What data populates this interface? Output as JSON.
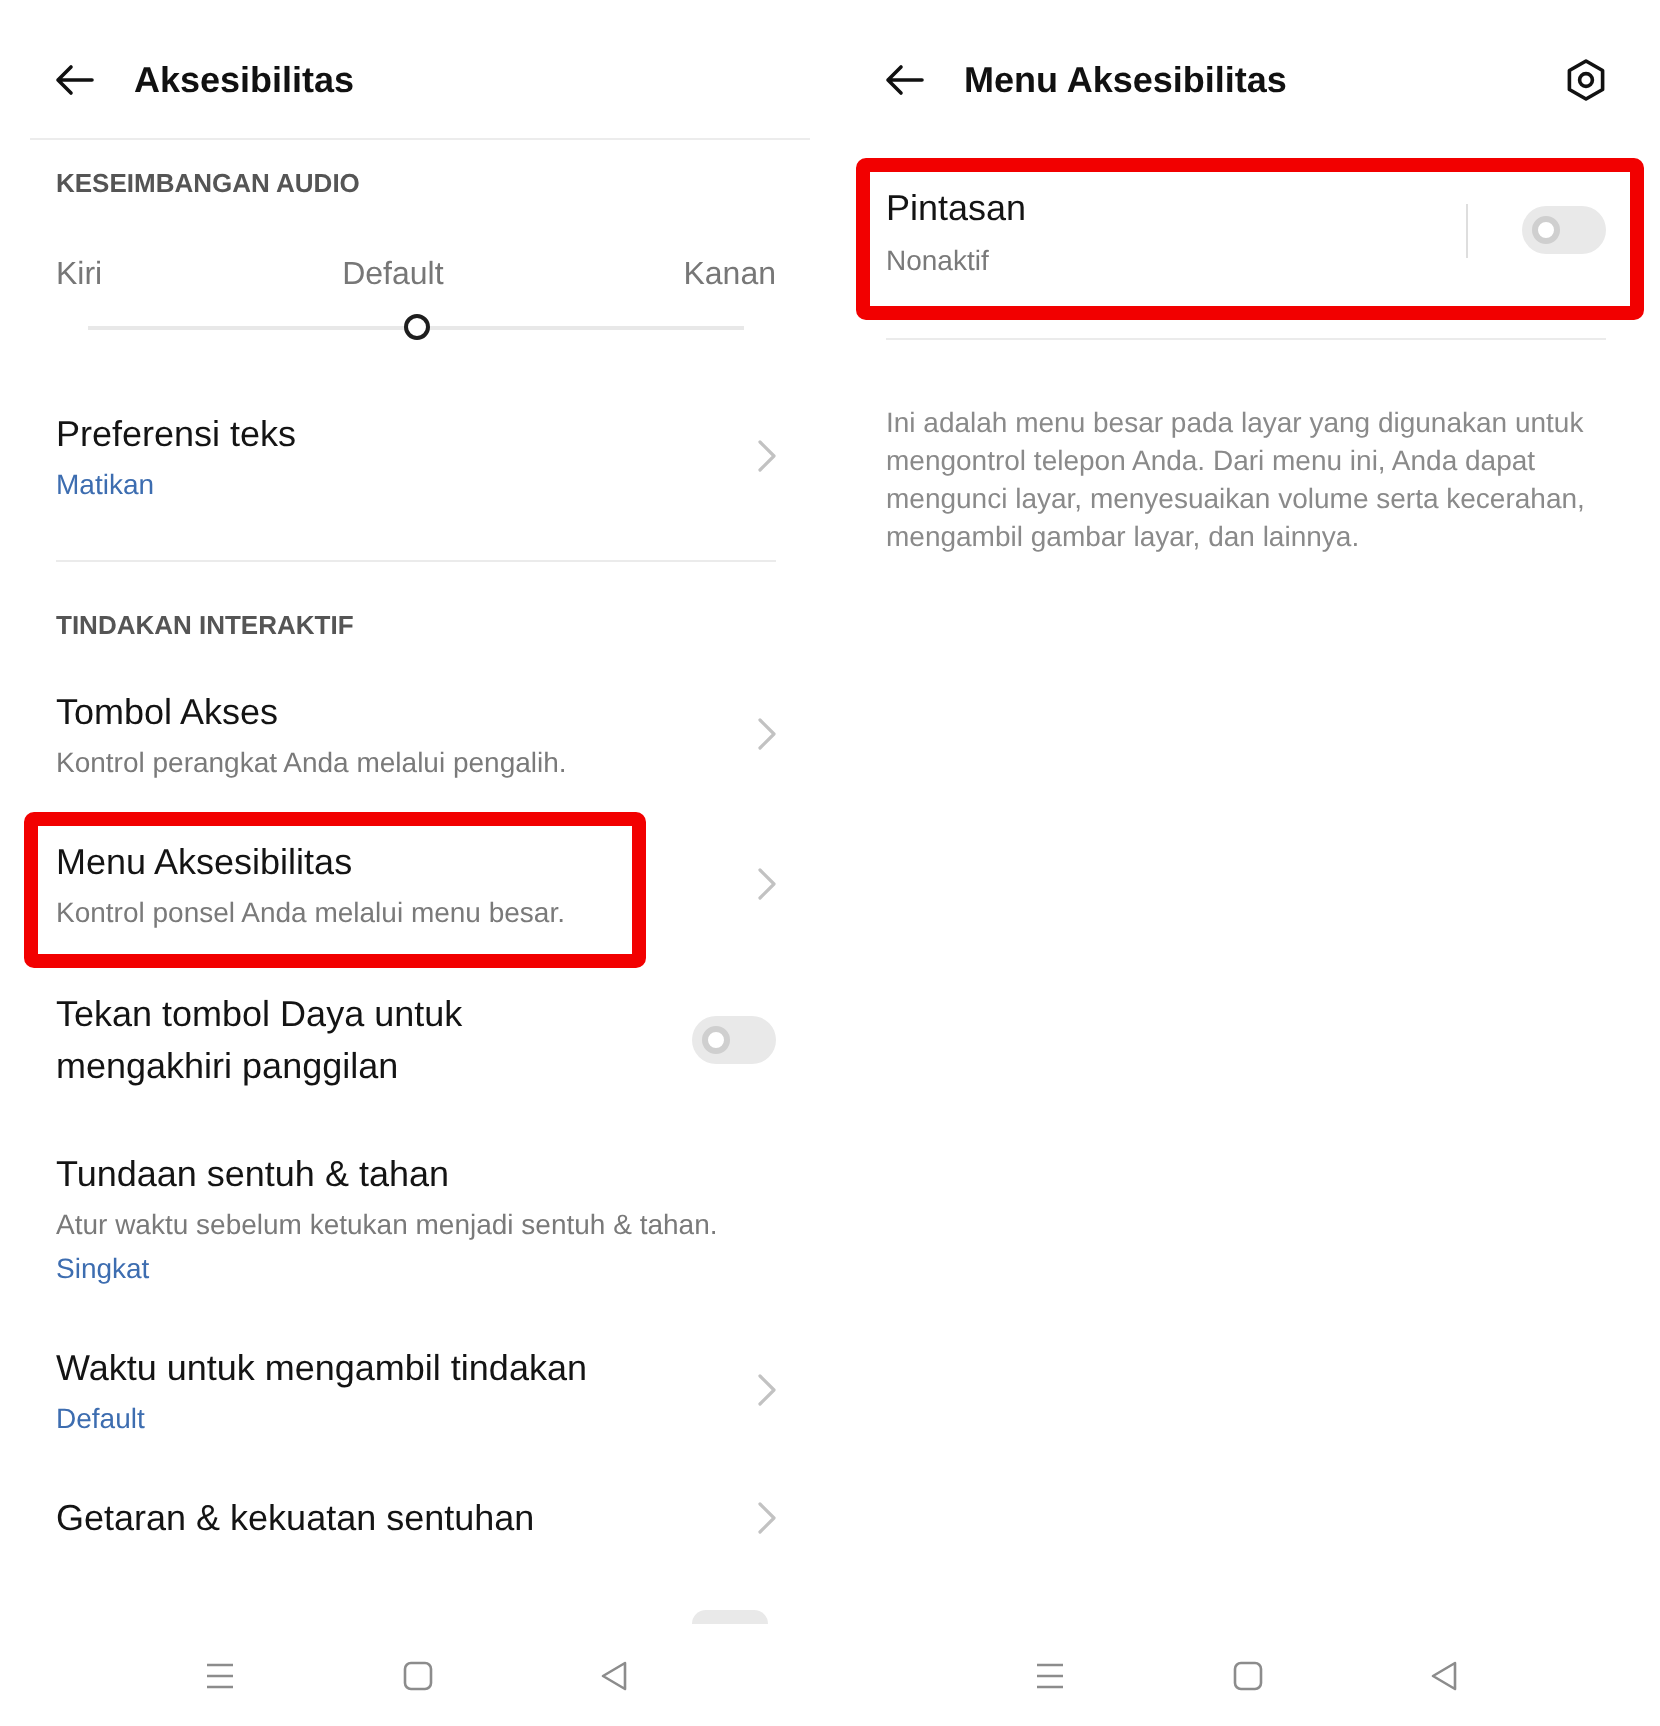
{
  "left_screen": {
    "title": "Aksesibilitas",
    "sections": [
      {
        "heading": "KESEIMBANGAN AUDIO",
        "items": [
          {
            "kind": "balance",
            "left_label": "Kiri",
            "center_label": "Default",
            "right_label": "Kanan",
            "level": 0.5
          },
          {
            "kind": "link",
            "title": "Preferensi teks",
            "value": "Matikan"
          }
        ]
      },
      {
        "heading": "TINDAKAN INTERAKTIF",
        "items": [
          {
            "kind": "link",
            "title": "Tombol Akses",
            "subtitle": "Kontrol perangkat Anda melalui pengalih.",
            "highlighted": false
          },
          {
            "kind": "link",
            "title": "Menu Aksesibilitas",
            "subtitle": "Kontrol ponsel Anda melalui menu besar.",
            "highlighted": true
          },
          {
            "kind": "toggle",
            "title": "Tekan tombol Daya untuk mengakhiri panggilan",
            "on": false,
            "highlighted": false
          },
          {
            "kind": "option",
            "title": "Tundaan sentuh & tahan",
            "subtitle": "Atur waktu sebelum ketukan menjadi sentuh & tahan.",
            "value": "Singkat",
            "highlighted": false
          },
          {
            "kind": "link",
            "title": "Waktu untuk mengambil tindakan",
            "value": "Default",
            "highlighted": false
          },
          {
            "kind": "link",
            "title": "Getaran & kekuatan sentuhan",
            "highlighted": false
          },
          {
            "kind": "toggle_peek",
            "on": false
          }
        ]
      }
    ]
  },
  "right_screen": {
    "title": "Menu Aksesibilitas",
    "rows": [
      {
        "kind": "toggle",
        "title": "Pintasan",
        "subtitle": "Nonaktif",
        "on": false,
        "highlighted": true
      }
    ],
    "description": "Ini adalah menu besar pada layar yang digunakan untuk mengontrol telepon Anda. Dari menu ini, Anda dapat mengunci layar, menyesuaikan volume serta kecerahan, mengambil gambar layar, dan lainnya."
  }
}
